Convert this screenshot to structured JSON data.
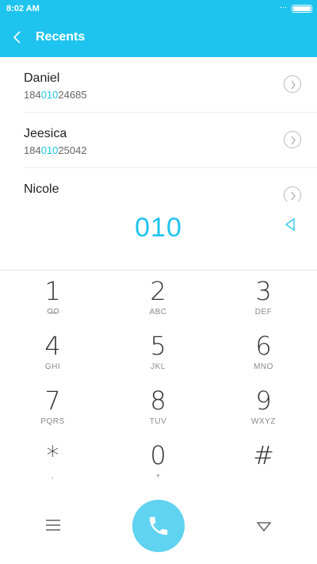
{
  "status": {
    "time": "8:02 AM",
    "dots": "..."
  },
  "header": {
    "title": "Recents"
  },
  "recents": [
    {
      "name": "Daniel",
      "number_prefix": "184",
      "number_match": "010",
      "number_suffix": "24685"
    },
    {
      "name": "Jeesica",
      "number_prefix": "184",
      "number_match": "010",
      "number_suffix": "25042"
    },
    {
      "name": "Nicole",
      "number_prefix": "",
      "number_match": "",
      "number_suffix": ""
    }
  ],
  "dialed_number": "010",
  "keypad": [
    {
      "digit": "1",
      "sub": ""
    },
    {
      "digit": "2",
      "sub": "ABC"
    },
    {
      "digit": "3",
      "sub": "DEF"
    },
    {
      "digit": "4",
      "sub": "GHI"
    },
    {
      "digit": "5",
      "sub": "JKL"
    },
    {
      "digit": "6",
      "sub": "MNO"
    },
    {
      "digit": "7",
      "sub": "PQRS"
    },
    {
      "digit": "8",
      "sub": "TUV"
    },
    {
      "digit": "9",
      "sub": "WXYZ"
    },
    {
      "digit": "*",
      "sub": ","
    },
    {
      "digit": "0",
      "sub": "+"
    },
    {
      "digit": "#",
      "sub": ""
    }
  ],
  "icons": {
    "back": "back-arrow-icon",
    "recent_detail": "chevron-right-circle-icon",
    "delete": "backspace-icon",
    "voicemail": "voicemail-icon",
    "menu": "menu-icon",
    "call": "phone-icon",
    "collapse": "collapse-keypad-icon"
  },
  "colors": {
    "accent": "#1fc4ee",
    "call_button": "#5fd3f0"
  }
}
